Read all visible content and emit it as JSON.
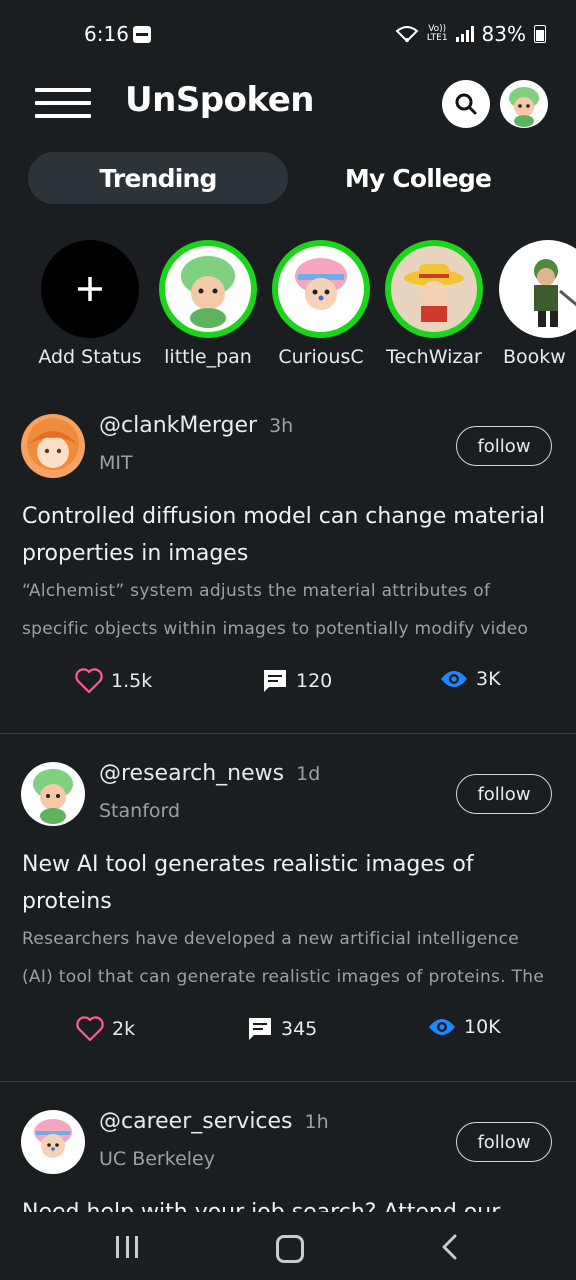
{
  "status_bar": {
    "time": "6:16",
    "network_top": "Vo))",
    "network_bottom": "LTE1",
    "battery": "83%"
  },
  "header": {
    "title": "UnSpoken",
    "search_icon": "search-icon",
    "avatar": "chopper-avatar"
  },
  "tabs": [
    {
      "label": "Trending",
      "active": true
    },
    {
      "label": "My College",
      "active": false
    }
  ],
  "stories": [
    {
      "name": "Add Status",
      "kind": "add"
    },
    {
      "name": "little_pan",
      "kind": "avatar-green"
    },
    {
      "name": "CuriousC",
      "kind": "avatar-pink"
    },
    {
      "name": "TechWizar",
      "kind": "avatar-hat"
    },
    {
      "name": "Bookw",
      "kind": "avatar-warrior"
    }
  ],
  "posts": [
    {
      "username": "@clankMerger",
      "time": "3h",
      "college": "MIT",
      "follow_label": "follow",
      "title": "Controlled diffusion model can change material properties in images",
      "excerpt_line1": "“Alchemist” system adjusts the material attributes of",
      "excerpt_line2": "specific objects within images to potentially modify video",
      "likes": "1.5k",
      "comments": "120",
      "views": "3K"
    },
    {
      "username": "@research_news",
      "time": "1d",
      "college": "Stanford",
      "follow_label": "follow",
      "title": "New AI tool generates realistic images of proteins",
      "excerpt_line1": "Researchers have developed a new artificial intelligence",
      "excerpt_line2": "(AI) tool that can generate realistic images of proteins. The",
      "likes": "2k",
      "comments": "345",
      "views": "10K"
    },
    {
      "username": "@career_services",
      "time": "1h",
      "college": "UC Berkeley",
      "follow_label": "follow",
      "title": "Need help with your job search? Attend our"
    }
  ],
  "colors": {
    "background": "#1a1e21",
    "like": "#ff5c8a",
    "views": "#1e88ff",
    "story_ring": "#1bd51b"
  }
}
